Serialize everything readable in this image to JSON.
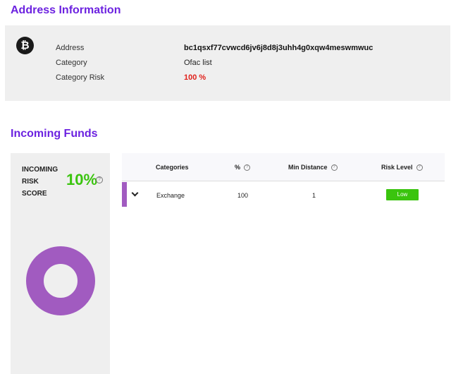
{
  "address_section": {
    "title": "Address Information",
    "rows": [
      {
        "label": "Address",
        "value": "bc1qsxf77cvwcd6jv6j8d8j3uhh4g0xqw4meswmwuc"
      },
      {
        "label": "Category",
        "value": "Ofac list"
      },
      {
        "label": "Category Risk",
        "value": "100 %"
      }
    ],
    "icon": "bitcoin-icon"
  },
  "funds_section": {
    "title": "Incoming Funds",
    "score_label": [
      "INCOMING",
      "RISK",
      "SCORE"
    ],
    "score_value": "10%",
    "help_glyph": "?",
    "donut": {
      "segments": [
        {
          "category": "Exchange",
          "value": 100,
          "color": "#a15bc0"
        }
      ]
    },
    "table": {
      "headers": [
        "Categories",
        "%",
        "Min Distance",
        "Risk Level"
      ],
      "rows": [
        {
          "category": "Exchange",
          "percent": "100",
          "min_distance": "1",
          "risk_level": "Low"
        }
      ]
    }
  },
  "colors": {
    "accent": "#6c22e0",
    "risk_red": "#e0201a",
    "low_green": "#3ac40e",
    "donut_purple": "#a15bc0"
  }
}
